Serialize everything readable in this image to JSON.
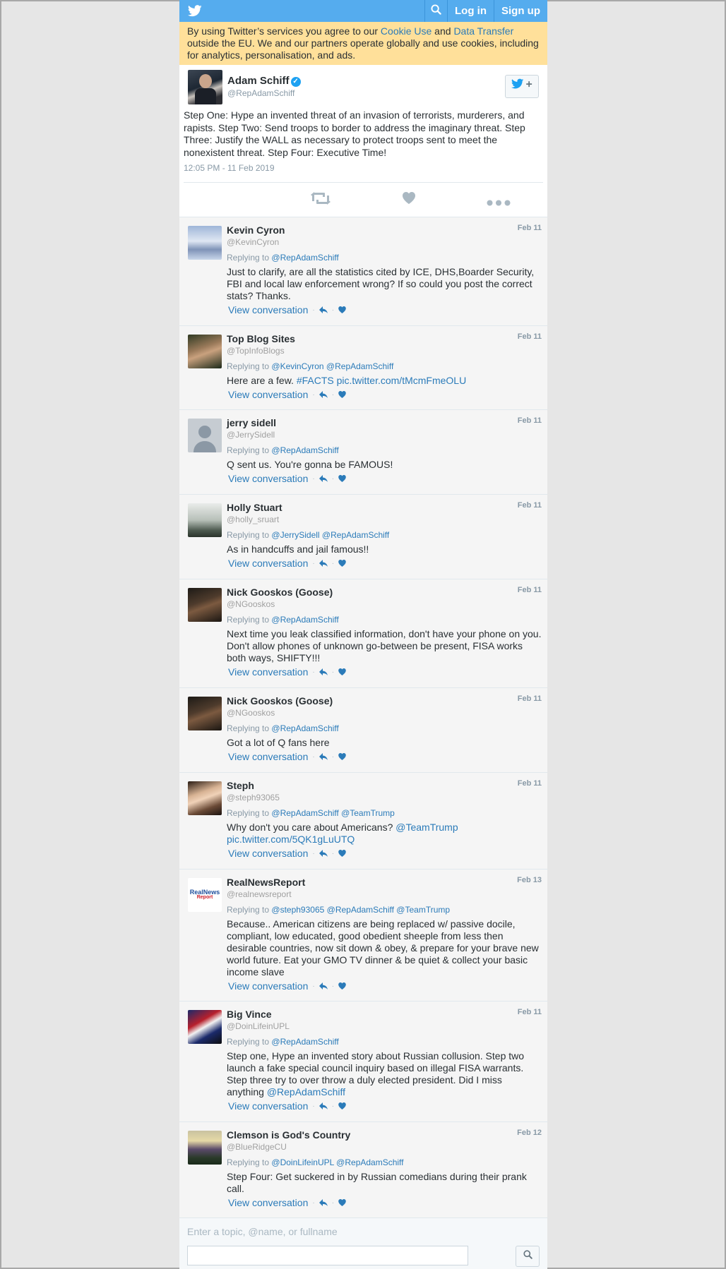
{
  "topbar": {
    "login_label": "Log in",
    "signup_label": "Sign up"
  },
  "cookie": {
    "text_before": "By using Twitter’s services you agree to our ",
    "cookie_link": "Cookie Use",
    "and": " and ",
    "transfer_link": "Data Transfer",
    "text_after": " outside the EU. We and our partners operate globally and use cookies, including for analytics, personalisation, and ads."
  },
  "tweet": {
    "name": "Adam Schiff",
    "handle": "@RepAdamSchiff",
    "text": "Step One: Hype an invented threat of an invasion of terrorists, murderers, and rapists. Step Two: Send troops to border to address the imaginary threat. Step Three: Justify the WALL as necessary to protect troops sent to meet the nonexistent threat. Step Four: Executive Time!",
    "time": "12:05 PM - 11 Feb 2019"
  },
  "view_conversation": "View conversation",
  "replying_to": "Replying to",
  "replies": [
    {
      "name": "Kevin Cyron",
      "handle": "@KevinCyron",
      "date": "Feb 11",
      "to": "@RepAdamSchiff",
      "text": "Just to clarify, are all the statistics cited by ICE, DHS,Boarder Security, FBI and local law enforcement wrong? If so could you post the correct stats? Thanks.",
      "link": ""
    },
    {
      "name": "Top Blog Sites",
      "handle": "@TopInfoBlogs",
      "date": "Feb 11",
      "to": "@KevinCyron @RepAdamSchiff",
      "text": "Here are a few. ",
      "link": "#FACTS pic.twitter.com/tMcmFmeOLU"
    },
    {
      "name": "jerry sidell",
      "handle": "@JerrySidell",
      "date": "Feb 11",
      "to": "@RepAdamSchiff",
      "text": "Q sent us. You're gonna be FAMOUS!",
      "link": ""
    },
    {
      "name": "Holly Stuart",
      "handle": "@holly_sruart",
      "date": "Feb 11",
      "to": "@JerrySidell @RepAdamSchiff",
      "text": "As in handcuffs and jail famous!!",
      "link": ""
    },
    {
      "name": "Nick Gooskos (Goose)",
      "handle": "@NGooskos",
      "date": "Feb 11",
      "to": "@RepAdamSchiff",
      "text": "Next time you leak classified information, don't have your phone on you. Don't allow phones of unknown go-between be present, FISA works both ways, SHIFTY!!!",
      "link": ""
    },
    {
      "name": "Nick Gooskos (Goose)",
      "handle": "@NGooskos",
      "date": "Feb 11",
      "to": "@RepAdamSchiff",
      "text": "Got a lot of Q fans here",
      "link": ""
    },
    {
      "name": "Steph",
      "handle": "@steph93065",
      "date": "Feb 11",
      "to": "@RepAdamSchiff @TeamTrump",
      "text": "Why don't you care about Americans? ",
      "link": "@TeamTrump pic.twitter.com/5QK1gLuUTQ"
    },
    {
      "name": "RealNewsReport",
      "handle": "@realnewsreport",
      "date": "Feb 13",
      "to": "@steph93065 @RepAdamSchiff @TeamTrump",
      "text": "Because.. American citizens are being replaced w/ passive docile, compliant, low educated, good obedient sheeple from less then desirable countries, now sit down & obey, & prepare for your brave new world future. Eat your GMO TV dinner & be quiet & collect your basic income slave",
      "link": ""
    },
    {
      "name": "Big Vince",
      "handle": "@DoinLifeinUPL",
      "date": "Feb 11",
      "to": "@RepAdamSchiff",
      "text": "Step one, Hype an invented story about Russian collusion. Step two launch a fake special council inquiry based on illegal FISA warrants. Step three try to over throw a duly elected president. Did I miss anything ",
      "link": "@RepAdamSchiff"
    },
    {
      "name": "Clemson is God's Country",
      "handle": "@BlueRidgeCU",
      "date": "Feb 12",
      "to": "@DoinLifeinUPL @RepAdamSchiff",
      "text": "Step Four: Get suckered in by Russian comedians during their prank call.",
      "link": ""
    }
  ],
  "search": {
    "placeholder": "Enter a topic, @name, or fullname"
  },
  "avatar_logo_text": {
    "line1": "RealNews",
    "line2": "Report"
  }
}
